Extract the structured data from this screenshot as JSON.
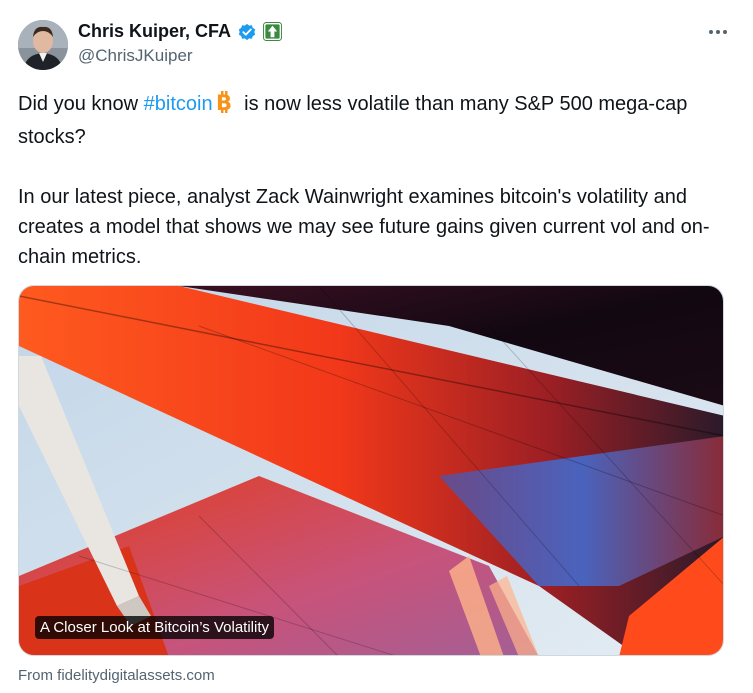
{
  "author": {
    "name": "Chris Kuiper, CFA",
    "handle": "@ChrisJKuiper"
  },
  "tweet": {
    "p1_before": "Did you know ",
    "hashtag": "#bitcoin",
    "p1_after": " is now less volatile than many S&P 500 mega-cap stocks?",
    "p2": "In our latest piece, analyst Zack Wainwright examines bitcoin's volatility and creates a model that shows we may see future gains given current vol and on-chain metrics."
  },
  "card": {
    "title": "A Closer Look at Bitcoin’s Volatility",
    "source": "From fidelitydigitalassets.com"
  },
  "icons": {
    "verified": "verified-check-icon",
    "affiliate": "fidelity-affiliate-badge",
    "bitcoin": "bitcoin-emoji-icon",
    "more": "more-dots-icon"
  },
  "colors": {
    "hashtag": "#1d9bf0",
    "verified": "#1d9bf0",
    "affiliate": "#3a8a3f",
    "bitcoin": "#f7931a",
    "secondary_text": "#536471"
  }
}
